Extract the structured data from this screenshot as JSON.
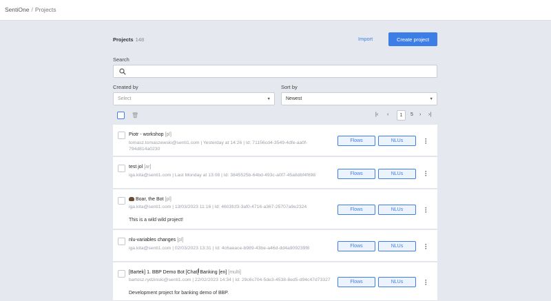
{
  "breadcrumb": {
    "root": "SentiOne",
    "separator": "/",
    "current": "Projects"
  },
  "header": {
    "title": "Projects",
    "count": "148",
    "import_label": "Import",
    "create_label": "Create project"
  },
  "search": {
    "label": "Search",
    "placeholder": "",
    "value": ""
  },
  "filters": {
    "created_by_label": "Created by",
    "created_by_placeholder": "Select",
    "sort_by_label": "Sort by",
    "sort_by_value": "Newest"
  },
  "pagination": {
    "first": "|‹",
    "prev": "‹",
    "current": "1",
    "last_page": "5",
    "next": "›",
    "last": "›|"
  },
  "projects": [
    {
      "name": "Piotr - workshop",
      "lang": "[pl]",
      "meta": "tomasz.tomaszewski@senti1.com | Yesterday at 14:26 | Id: 71156cd4-3549-4dfe-aa0f-794d814a0230",
      "desc": "",
      "flows": "Flows",
      "nlus": "NLUs"
    },
    {
      "name": "test jol",
      "lang": "[ar]",
      "meta": "iga.kita@senti1.com | Last Monday at 13:08 | Id: 3845525b-64bd-493c-a0f7-45a8dbf4f698",
      "desc": "",
      "flows": "Flows",
      "nlus": "NLUs"
    },
    {
      "name": "Boar, the Bot",
      "lang": "[pl]",
      "meta": "iga.kita@senti1.com | 13/03/2023 11:16 | Id: 4603fcf3-3af0-4716-a367-25707a9e2324",
      "desc": "This is a wild wild project!",
      "flows": "Flows",
      "nlus": "NLUs"
    },
    {
      "name": "nlu-variables changes",
      "lang": "[pl]",
      "meta": "iga.kita@senti1.com | 02/03/2023 13:31 | Id: 4c6aeace-b989-43be-a46d-dd4a909239f8",
      "desc": "",
      "flows": "Flows",
      "nlus": "NLUs"
    },
    {
      "name": "[Bartek] 1. BBP Demo Bot [Chat] Banking [en]",
      "lang": "[multi]",
      "meta": "bartosz.rydzinski@senti1.com | 22/02/2023 14:34 | Id: 29c6c704-5de3-4538-8ed5-d94c47d73327",
      "desc": "Development project for banking demo of BBP.",
      "flows": "Flows",
      "nlus": "NLUs"
    }
  ],
  "icons": {
    "search": "search-icon",
    "trash": "trash-icon",
    "kebab": "kebab-menu-icon"
  },
  "colors": {
    "accent": "#3d7ee6",
    "background": "#e5e8ee"
  }
}
